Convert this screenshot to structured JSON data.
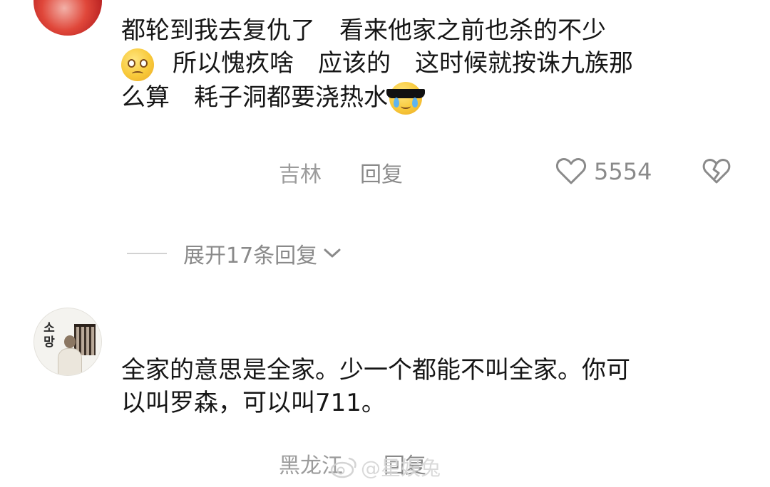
{
  "comments": [
    {
      "lines": [
        "都轮到我去复仇了　看来他家之前也杀的不少",
        "所以愧疚啥　应该的　这时候就按诛九族那",
        "么算　耗子洞都要浇热水"
      ],
      "location": "吉林",
      "reply_label": "回复",
      "like_count": "5554",
      "emoji_inline": [
        "pleading-face-emoji",
        "crying-sunglasses-emoji"
      ]
    },
    {
      "avatar_text": "소\n망",
      "lines": [
        "全家的意思是全家。少一个都能不叫全家。你可",
        "以叫罗森，可以叫711。"
      ],
      "location": "黑龙江",
      "reply_label": "回复"
    }
  ],
  "expand_replies": {
    "label": "展开17条回复"
  },
  "watermark": {
    "text": "@星娱兔"
  },
  "icons": {
    "like": "heart-outline-icon",
    "dislike": "broken-heart-icon",
    "expand": "chevron-down-icon",
    "watermark": "weibo-logo-icon"
  },
  "colors": {
    "text": "#161616",
    "meta": "#9c9c9c",
    "secondary": "#8a8a8a",
    "emoji_yellow": "#f8c93a"
  }
}
